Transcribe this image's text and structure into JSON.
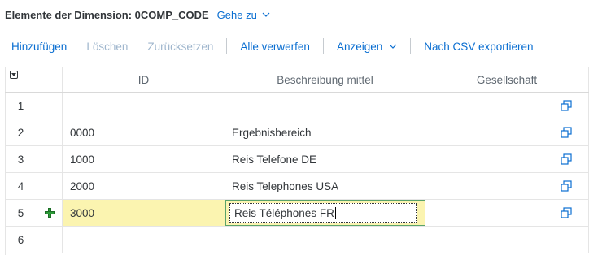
{
  "header": {
    "title": "Elemente der Dimension: 0COMP_CODE",
    "goto_label": "Gehe zu"
  },
  "toolbar": {
    "add": "Hinzufügen",
    "delete": "Löschen",
    "reset": "Zurücksetzen",
    "discard_all": "Alle verwerfen",
    "show": "Anzeigen",
    "export_csv": "Nach CSV exportieren"
  },
  "table": {
    "columns": {
      "id": "ID",
      "description": "Beschreibung mittel",
      "company": "Gesellschaft"
    },
    "rows": [
      {
        "num": "1",
        "id": "",
        "description": ""
      },
      {
        "num": "2",
        "id": "0000",
        "description": "Ergebnisbereich"
      },
      {
        "num": "3",
        "id": "1000",
        "description": "Reis Telefone DE"
      },
      {
        "num": "4",
        "id": "2000",
        "description": "Reis Telephones USA"
      },
      {
        "num": "5",
        "id": "3000",
        "description": "Reis Téléphones FR"
      },
      {
        "num": "6",
        "id": "",
        "description": ""
      }
    ]
  },
  "colors": {
    "accent": "#0a6ed1",
    "highlight": "#fbf4b0",
    "new_row_icon": "#2b9a37"
  },
  "icons": {
    "goto_chevron": "chevron-down-icon",
    "show_chevron": "chevron-down-icon",
    "new_row": "plus-icon",
    "value_help": "value-help-icon",
    "column_menu": "column-menu-icon"
  }
}
